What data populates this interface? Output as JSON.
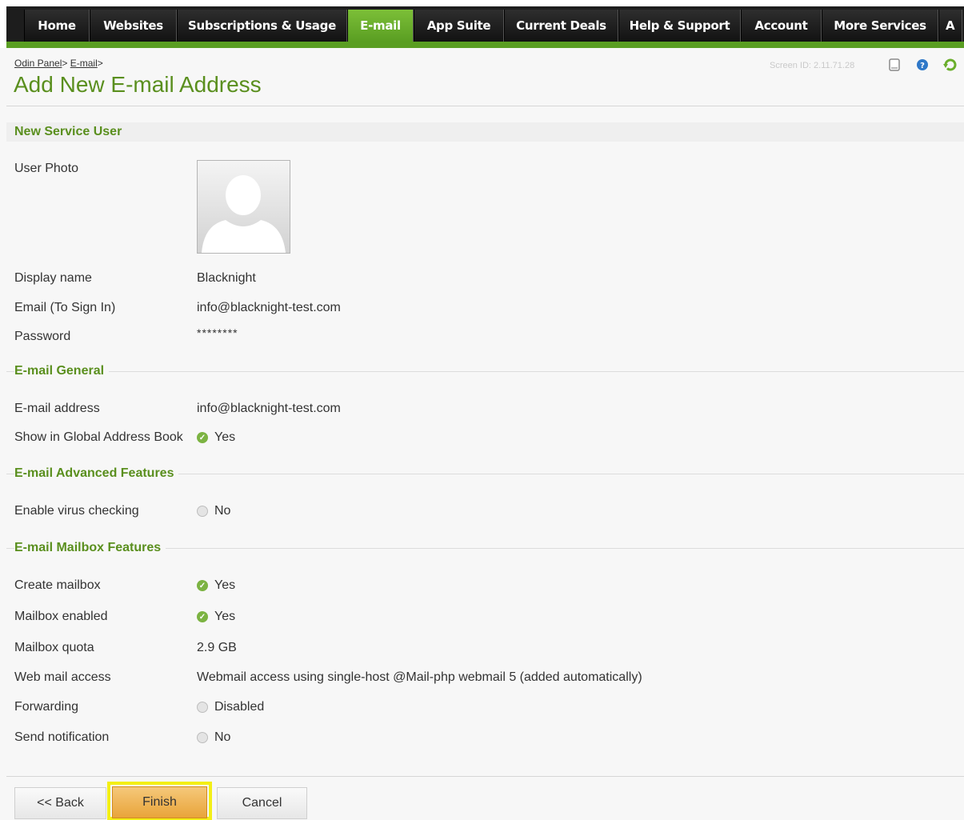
{
  "nav": {
    "tabs": [
      {
        "label": "Home",
        "active": false
      },
      {
        "label": "Websites",
        "active": false
      },
      {
        "label": "Subscriptions & Usage",
        "active": false
      },
      {
        "label": "E-mail",
        "active": true
      },
      {
        "label": "App Suite",
        "active": false
      },
      {
        "label": "Current Deals",
        "active": false
      },
      {
        "label": "Help & Support",
        "active": false
      },
      {
        "label": "Account",
        "active": false
      },
      {
        "label": "More Services",
        "active": false
      },
      {
        "label": "A",
        "active": false
      }
    ]
  },
  "breadcrumb": {
    "items": [
      "Odin Panel",
      "E-mail"
    ],
    "separator": ">"
  },
  "page": {
    "title": "Add New E-mail Address"
  },
  "header": {
    "screen_id": "Screen ID: 2.11.71.28",
    "icons": [
      "bookmark-icon",
      "help-icon",
      "refresh-icon"
    ]
  },
  "colors": {
    "accent": "#5a8f1e",
    "nav_active": "#6aae2b",
    "finish_button": "#e9a43a",
    "highlight": "#f3ef16"
  },
  "sections": {
    "service_user": {
      "title": "New Service User",
      "user_photo_label": "User Photo",
      "display_name_label": "Display name",
      "display_name": "Blacknight",
      "email_label": "Email (To Sign In)",
      "email": "info@blacknight-test.com",
      "password_label": "Password",
      "password": "********"
    },
    "email_general": {
      "title": "E-mail General",
      "address_label": "E-mail address",
      "address": "info@blacknight-test.com",
      "gab_label": "Show in Global Address Book",
      "gab": "Yes"
    },
    "advanced": {
      "title": "E-mail Advanced Features",
      "virus_label": "Enable virus checking",
      "virus": "No"
    },
    "mailbox": {
      "title": "E-mail Mailbox Features",
      "create_label": "Create mailbox",
      "create": "Yes",
      "enabled_label": "Mailbox enabled",
      "enabled": "Yes",
      "quota_label": "Mailbox quota",
      "quota": "2.9 GB",
      "webmail_label": "Web mail access",
      "webmail": "Webmail access using single-host @Mail-php webmail 5 (added automatically)",
      "forwarding_label": "Forwarding",
      "forwarding": "Disabled",
      "notification_label": "Send notification",
      "notification": "No"
    }
  },
  "buttons": {
    "back": "<< Back",
    "finish": "Finish",
    "cancel": "Cancel"
  }
}
